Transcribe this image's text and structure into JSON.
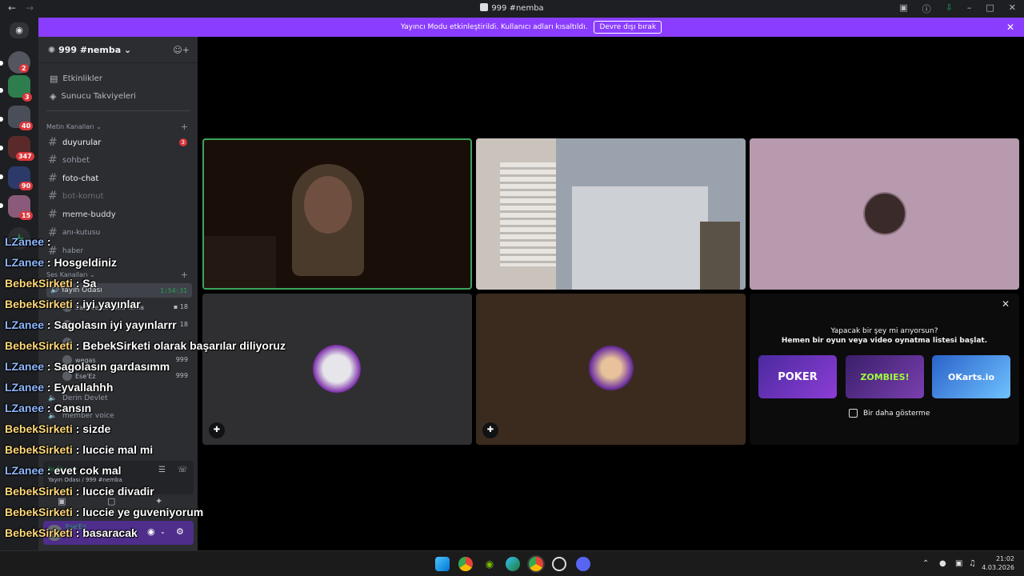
{
  "window": {
    "title": "999 #nemba"
  },
  "notice": {
    "text": "Yayıncı Modu etkinleştirildi. Kullanıcı adları kısaltıldı.",
    "button": "Devre dışı bırak"
  },
  "rail": {
    "servers": [
      {
        "badge": "2"
      },
      {
        "badge": "3"
      },
      {
        "badge": "40"
      },
      {
        "badge": "347"
      },
      {
        "badge": "90"
      },
      {
        "badge": "15"
      }
    ]
  },
  "sidebar": {
    "server_name": "999 #nemba",
    "events": "Etkinlikler",
    "boosts": "Sunucu Takviyeleri",
    "text_category": "Metin Kanalları",
    "voice_category": "Ses Kanalları",
    "channels": [
      {
        "name": "duyurular",
        "badge": "3"
      },
      {
        "name": "sohbet"
      },
      {
        "name": "foto-chat"
      },
      {
        "name": "bot-komut"
      },
      {
        "name": "meme-buddy"
      },
      {
        "name": "anı-kutusu"
      },
      {
        "name": "haber"
      }
    ],
    "voice": {
      "active": "Yayın Odası",
      "timer": "1:54:31",
      "users": [
        {
          "name": "Sadece Zımdad Tema",
          "count": "18"
        },
        {
          "name": "",
          "count": "18"
        },
        {
          "name": "",
          "count": ""
        },
        {
          "name": "wegas",
          "count": "999"
        },
        {
          "name": "Ese'Ez",
          "count": "999"
        }
      ],
      "other": [
        "Derin Devlet",
        "member voice"
      ]
    },
    "rtc": {
      "status": "bağlandı",
      "location": "Yayın Odası / 999 #nemba"
    },
    "user_panel": {
      "name": "Ese'Ez"
    }
  },
  "promo": {
    "line1": "Yapacak bir şey mi arıyorsun?",
    "line2": "Hemen bir oyun veya video oynatma listesi başlat.",
    "games": [
      "POKER",
      "ZOMBIES!",
      "OKarts.io"
    ],
    "checkbox": "Bir daha gösterme"
  },
  "chat": [
    {
      "user": "LZanee",
      "text": " : ",
      "cls": "u1"
    },
    {
      "user": "LZanee",
      "text": " : Hosgeldiniz",
      "cls": "u1"
    },
    {
      "user": "BebekSirketi",
      "text": " : Sa",
      "cls": "u2"
    },
    {
      "user": "BebekSirketi",
      "text": " : iyi yayınlar",
      "cls": "u2"
    },
    {
      "user": "LZanee",
      "text": " : Sagolasın iyi yayınlarrr",
      "cls": "u1"
    },
    {
      "user": "BebekSirketi",
      "text": " : BebekSirketi olarak başarılar diliyoruz",
      "cls": "u2"
    },
    {
      "user": "LZanee",
      "text": " : Sagolasın gardasımm",
      "cls": "u1"
    },
    {
      "user": "LZanee",
      "text": " : Eyvallahhh",
      "cls": "u1"
    },
    {
      "user": "LZanee",
      "text": " : Cansın",
      "cls": "u1"
    },
    {
      "user": "BebekSirketi",
      "text": " : sizde",
      "cls": "u2"
    },
    {
      "user": "BebekSirketi",
      "text": " : luccie mal mi",
      "cls": "u2"
    },
    {
      "user": "LZanee",
      "text": " : evet cok mal",
      "cls": "u1"
    },
    {
      "user": "BebekSirketi",
      "text": " : luccie divadir",
      "cls": "u2"
    },
    {
      "user": "BebekSirketi",
      "text": " : luccie ye guveniyorum",
      "cls": "u2"
    },
    {
      "user": "BebekSirketi",
      "text": " : basaracak",
      "cls": "u2"
    }
  ],
  "taskbar": {
    "time": "21:02",
    "date": "4.03.2026"
  }
}
